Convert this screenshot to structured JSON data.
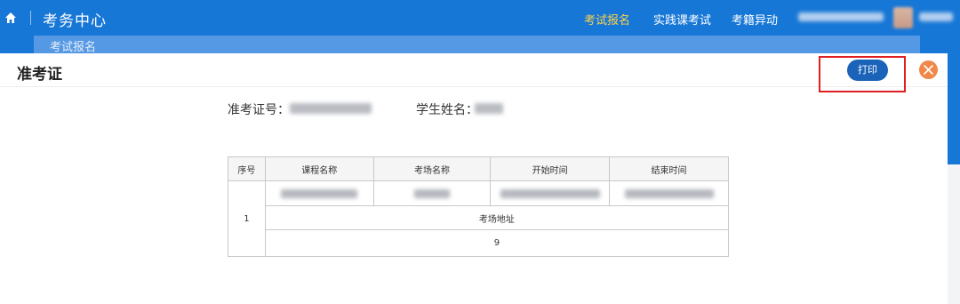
{
  "topbar": {
    "title": "考务中心",
    "nav": [
      {
        "label": "考试报名",
        "active": true
      },
      {
        "label": "实践课考试",
        "active": false
      },
      {
        "label": "考籍异动",
        "active": false
      }
    ],
    "active_color": "#ffd24a"
  },
  "tab": {
    "label": "考试报名"
  },
  "dialog": {
    "title": "准考证",
    "print_label": "打印",
    "admission_no_label": "准考证号：",
    "student_name_label": "学生姓名："
  },
  "table": {
    "headers": [
      "序号",
      "课程名称",
      "考场名称",
      "开始时间",
      "结束时间"
    ],
    "row_index": "1",
    "address_header": "考场地址",
    "address_value": "9"
  },
  "colors": {
    "primary": "#1777d6",
    "print_button": "#1b63b8",
    "close_button": "#f0884a",
    "highlight": "#e02020"
  }
}
